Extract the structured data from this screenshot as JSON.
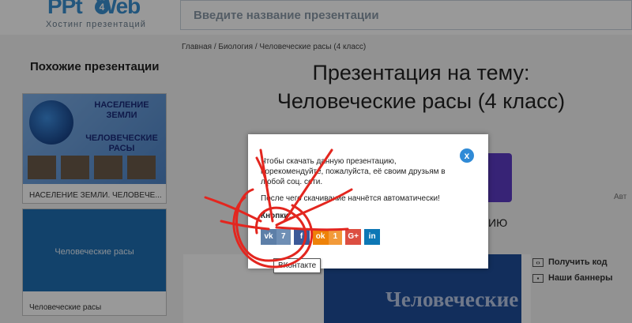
{
  "header": {
    "logo_main": "PPt",
    "logo_badge": "4",
    "logo_tail": "Web",
    "logo_sub": "Хостинг презентаций",
    "search_placeholder": "Введите название презентации"
  },
  "sidebar": {
    "title": "Похожие презентации",
    "cards": [
      {
        "img_line1": "НАСЕЛЕНИЕ ЗЕМЛИ",
        "img_line2": "ЧЕЛОВЕЧЕСКИЕ РАСЫ",
        "label": "НАСЕЛЕНИЕ ЗЕМЛИ. ЧЕЛОВЕЧЕ..."
      },
      {
        "img_text": "Человеческие расы",
        "label": "Человеческие расы"
      }
    ]
  },
  "main": {
    "breadcrumb": "Главная / Биология / Человеческие расы (4 класс)",
    "title": "Презентация на тему: Человеческие расы (4 класс)",
    "side_text": "Авт",
    "side_text2": "ИЮ",
    "slide_text": "Человеческие",
    "links": [
      "Получить код",
      "Наши баннеры"
    ]
  },
  "modal": {
    "text1": "Чтобы скачать данную презентацию, порекомендуйте, пожалуйста, её своим друзьям в любой соц. сети.",
    "text2": "После чего скачивание начнётся автоматически!",
    "buttons_label": "Кнопки:",
    "close_label": "x",
    "shares": [
      {
        "id": "vk",
        "icon": "vk-icon",
        "glyph": "vk",
        "count": "7"
      },
      {
        "id": "fb",
        "icon": "facebook-icon",
        "glyph": "f",
        "count": ""
      },
      {
        "id": "ok",
        "icon": "odnoklassniki-icon",
        "glyph": "ok",
        "count": "1"
      },
      {
        "id": "gp",
        "icon": "google-plus-icon",
        "glyph": "G+",
        "count": ""
      },
      {
        "id": "li",
        "icon": "linkedin-icon",
        "glyph": "in",
        "count": ""
      }
    ],
    "tooltip": "ВКонтакте"
  },
  "colors": {
    "accent": "#2f8ad6",
    "scribble": "#e3261f"
  }
}
